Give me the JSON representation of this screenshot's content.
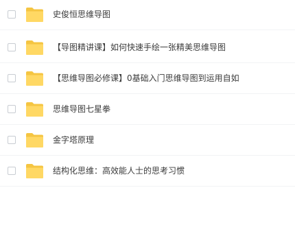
{
  "files": [
    {
      "name": "史俊恒思维导图",
      "type": "folder-icon"
    },
    {
      "name": "【导图精讲课】如何快速手绘一张精美思维导图",
      "type": "folder-icon"
    },
    {
      "name": "【思维导图必修课】0基础入门思维导图到运用自如",
      "type": "folder-icon"
    },
    {
      "name": "思维导图七星拳",
      "type": "folder-icon"
    },
    {
      "name": "金字塔原理",
      "type": "folder-icon"
    },
    {
      "name": "结构化思维：高效能人士的思考习惯",
      "type": "folder-icon"
    }
  ],
  "colors": {
    "folder_back": "#f5c542",
    "folder_front": "#ffd864",
    "divider": "#f2f3f5"
  }
}
